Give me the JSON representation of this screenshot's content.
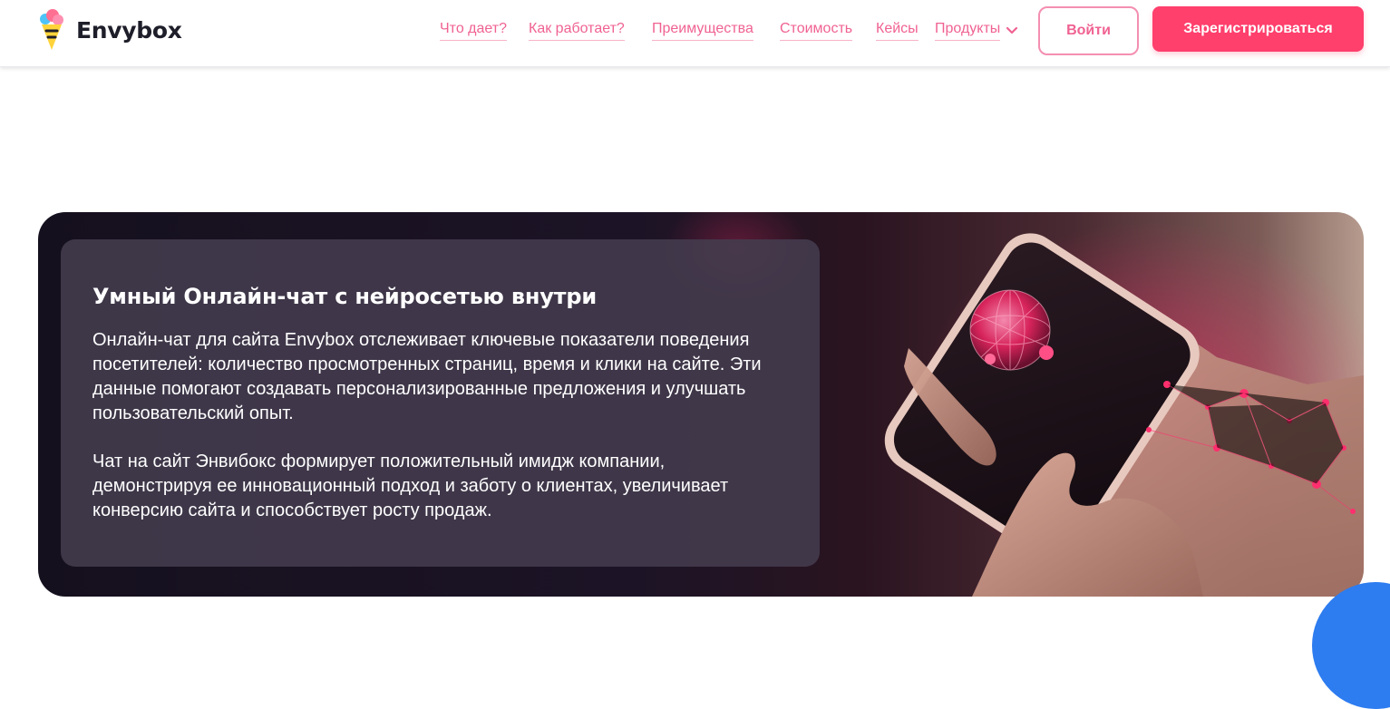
{
  "header": {
    "brand": "Envybox",
    "nav": [
      {
        "label": "Что дает?"
      },
      {
        "label": "Как работает?"
      },
      {
        "label": "Преимущества"
      },
      {
        "label": "Стоимость"
      },
      {
        "label": "Кейсы"
      },
      {
        "label": "Продукты",
        "icon": "chevron-down-icon"
      }
    ],
    "login_label": "Войти",
    "register_label": "Зарегистрироваться"
  },
  "banner": {
    "title": "Умный Онлайн-чат с нейросетью внутри",
    "paragraphs": [
      "Онлайн-чат для сайта Envybox отслеживает ключевые показатели поведения посетителей: количество просмотренных страниц, время и клики на сайте. Эти данные помогают создавать персонализированные предложения и улучшать пользовательский опыт.",
      "Чат на сайт Энвибокс формирует положительный имидж компании, демонстрируя ее инновационный подход и заботу о клиентах, увеличивает конверсию сайта и способствует росту продаж."
    ],
    "image": "hands-holding-smartphone-with-neural-network-sphere"
  },
  "colors": {
    "accent": "#ff3f6c",
    "link": "#f06292",
    "banner_dark": "#15101e",
    "card": "#443c4e",
    "blue_widget": "#2d7cf0"
  }
}
